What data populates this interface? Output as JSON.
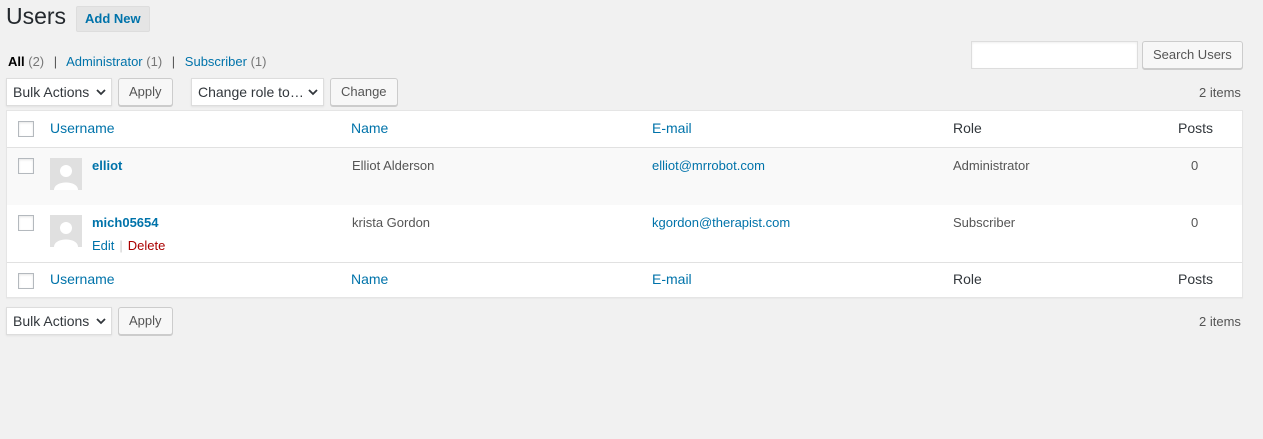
{
  "header": {
    "title": "Users",
    "add_new_label": "Add New"
  },
  "views": {
    "all": {
      "label": "All",
      "count": "(2)"
    },
    "administrator": {
      "label": "Administrator",
      "count": "(1)"
    },
    "subscriber": {
      "label": "Subscriber",
      "count": "(1)"
    },
    "separator": "|"
  },
  "search": {
    "value": "",
    "button_label": "Search Users"
  },
  "bulk_top": {
    "select_value": "Bulk Actions",
    "apply_label": "Apply"
  },
  "role_change": {
    "select_value": "Change role to…",
    "button_label": "Change"
  },
  "items_count": "2 items",
  "columns": {
    "username": "Username",
    "name": "Name",
    "email": "E-mail",
    "role": "Role",
    "posts": "Posts"
  },
  "users": [
    {
      "username": "elliot",
      "name": "Elliot Alderson",
      "email": "elliot@mrrobot.com",
      "role": "Administrator",
      "posts": "0"
    },
    {
      "username": "mich05654",
      "name": "krista Gordon",
      "email": "kgordon@therapist.com",
      "role": "Subscriber",
      "posts": "0"
    }
  ],
  "row_actions": {
    "edit": "Edit",
    "separator": "|",
    "delete": "Delete"
  },
  "bulk_bottom": {
    "select_value": "Bulk Actions",
    "apply_label": "Apply"
  },
  "colors": {
    "link": "#0073aa",
    "delete": "#a00",
    "background": "#f1f1f1",
    "row_alt": "#f9f9f9"
  }
}
